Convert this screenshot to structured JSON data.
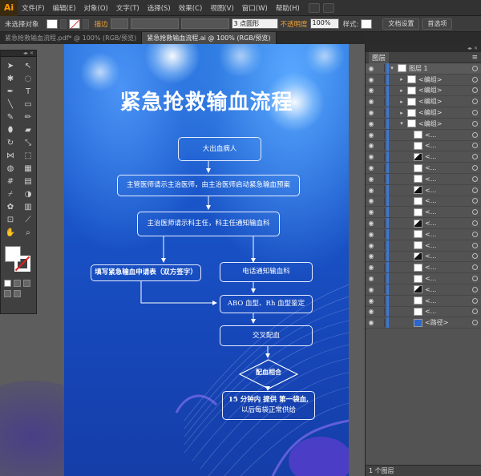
{
  "app": {
    "logo": "Ai"
  },
  "menu": [
    "文件(F)",
    "编辑(E)",
    "对象(O)",
    "文字(T)",
    "选择(S)",
    "效果(C)",
    "视图(V)",
    "窗口(W)",
    "帮助(H)"
  ],
  "control": {
    "selection": "未选择对象",
    "stroke_label": "描边",
    "point_value": "3 点圆形",
    "opacity_label": "不透明度",
    "opacity_value": "100%",
    "style_label": "样式:",
    "doc_setup": "文档设置",
    "preferences": "首选项"
  },
  "tabs": [
    {
      "label": "紧急抢救输血流程.pdf* @ 100% (RGB/预览)",
      "active": false
    },
    {
      "label": "紧急抢救输血流程.ai @ 100% (RGB/预览)",
      "active": true
    }
  ],
  "artwork": {
    "title": "紧急抢救输血流程",
    "boxes": {
      "b1": "大出血病人",
      "b2": "主管医师请示主治医师，由主治医师启动紧急输血预案",
      "b3": "主治医师请示科主任，科主任通知输血科",
      "b4": "填写紧急输血申请表（双方签字）",
      "b5": "电话通知输血科",
      "b6": "ABO 血型、Rh 血型鉴定",
      "b7": "交叉配血",
      "b8_line1": "15 分钟内  提供  第一袋血,",
      "b8_line2": "以后每袋正常供给"
    },
    "diamond": "配血相合"
  },
  "layers": {
    "tab_label": "图层",
    "layer1": "图层 1",
    "items": [
      "<编组>",
      "<编组>",
      "<编组>",
      "<编组>",
      "<编组>",
      "<...",
      "<...",
      "<...",
      "<...",
      "<...",
      "<...",
      "<...",
      "<...",
      "<...",
      "<...",
      "<...",
      "<...",
      "<...",
      "<...",
      "<...",
      "<...",
      "<...",
      "<路径>"
    ],
    "footer": "1 个图层"
  },
  "colors": {
    "accent_orange": "#ff9a00",
    "artboard_blue": "#1a58cc",
    "layer_blue": "#3a78d8"
  }
}
